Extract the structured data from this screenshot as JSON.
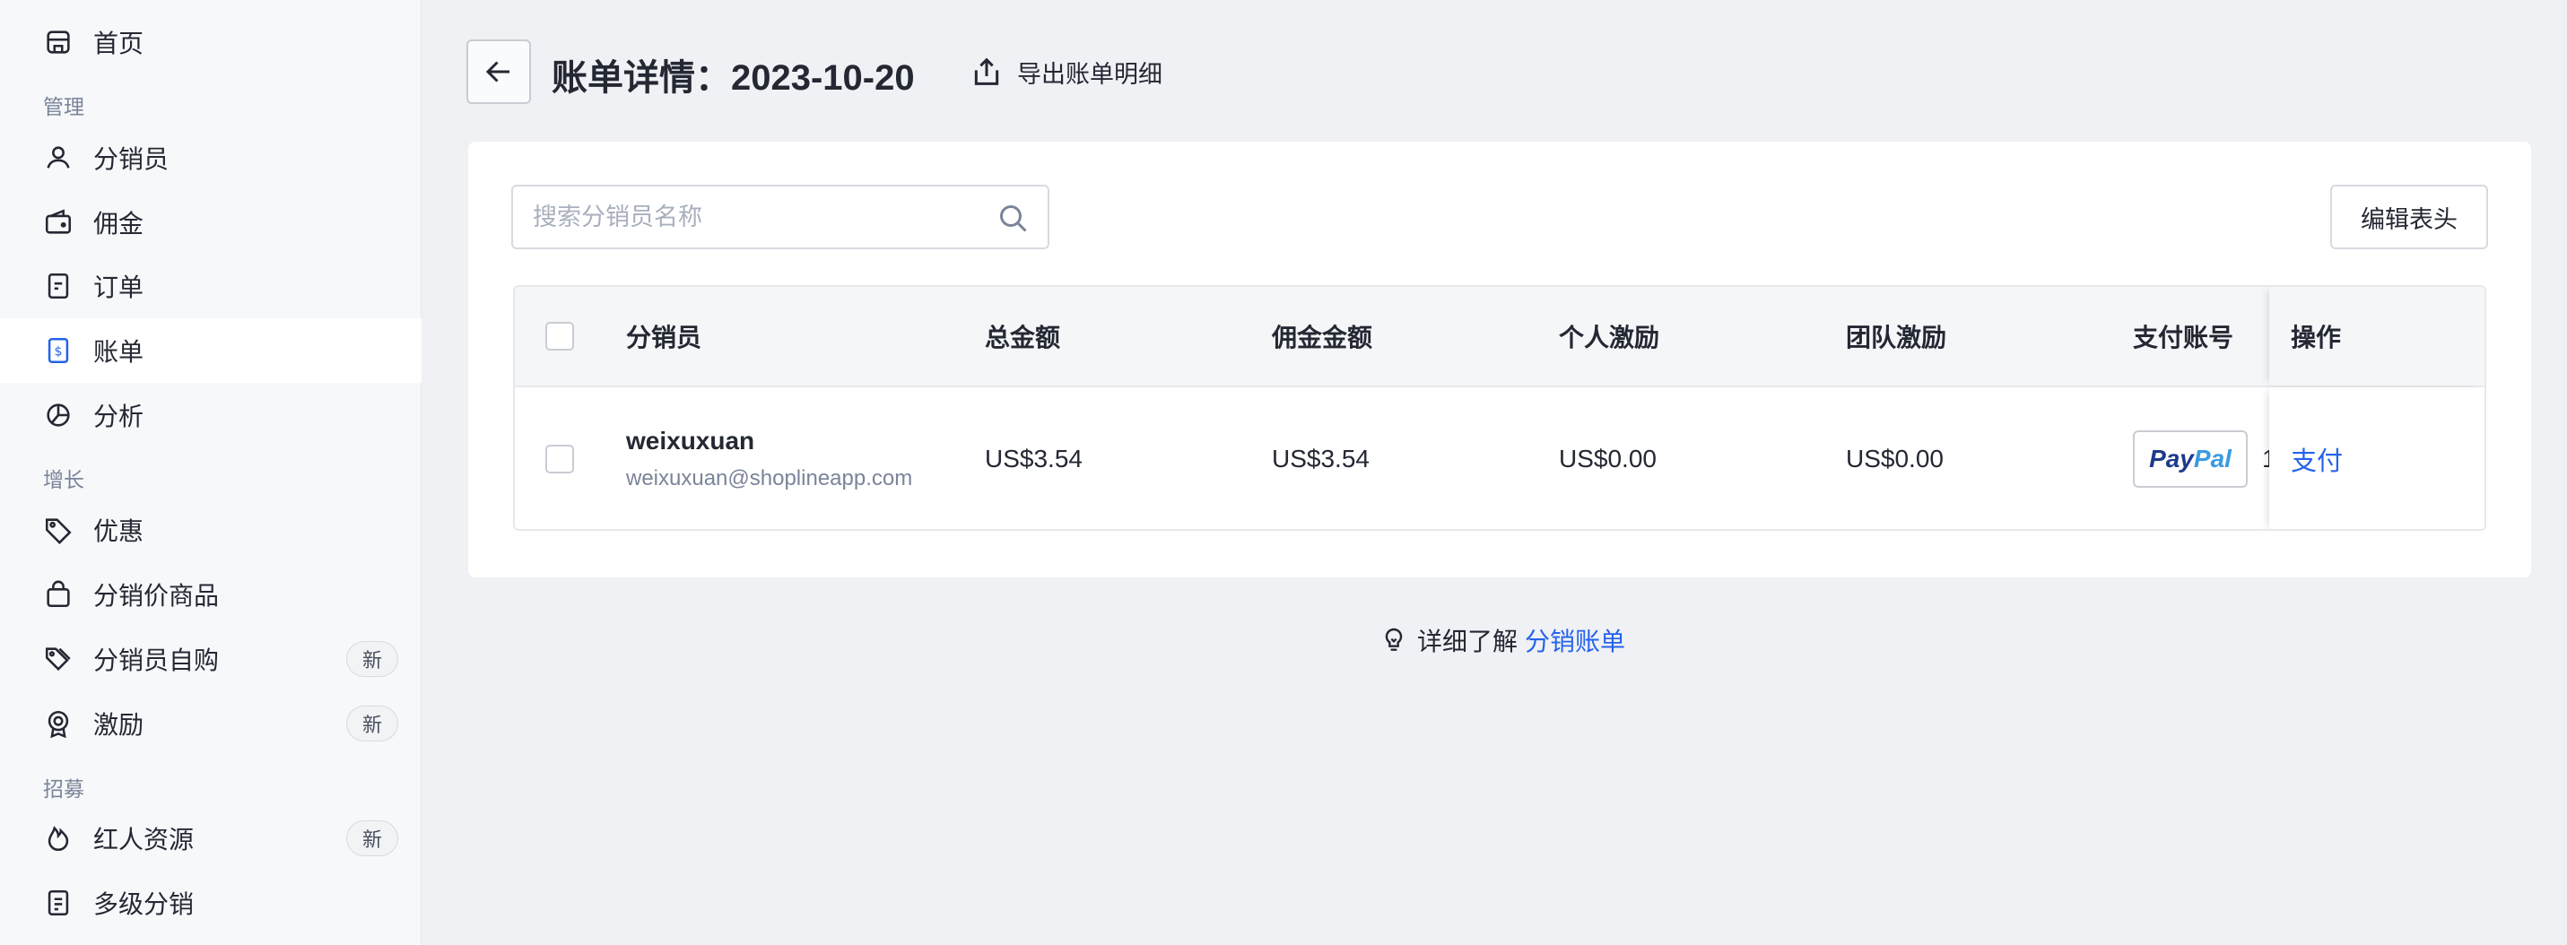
{
  "sidebar": {
    "items": [
      {
        "label": "首页",
        "icon": "store-icon"
      },
      {
        "label": "分销员",
        "icon": "user-icon"
      },
      {
        "label": "佣金",
        "icon": "wallet-icon"
      },
      {
        "label": "订单",
        "icon": "order-icon"
      },
      {
        "label": "账单",
        "icon": "bill-icon",
        "active": true
      },
      {
        "label": "分析",
        "icon": "pie-chart-icon"
      },
      {
        "label": "优惠",
        "icon": "tag-icon"
      },
      {
        "label": "分销价商品",
        "icon": "bag-icon"
      },
      {
        "label": "分销员自购",
        "icon": "tags-icon",
        "badge": "新"
      },
      {
        "label": "激励",
        "icon": "medal-icon",
        "badge": "新"
      },
      {
        "label": "红人资源",
        "icon": "flame-icon",
        "badge": "新"
      },
      {
        "label": "多级分销",
        "icon": "document-icon"
      }
    ],
    "sections": {
      "manage": "管理",
      "growth": "增长",
      "recruit": "招募"
    }
  },
  "header": {
    "title": "账单详情：2023-10-20",
    "export_label": "导出账单明细"
  },
  "search": {
    "placeholder": "搜索分销员名称"
  },
  "toolbar": {
    "edit_header_label": "编辑表头"
  },
  "table": {
    "columns": [
      "分销员",
      "总金额",
      "佣金金额",
      "个人激励",
      "团队激励",
      "支付账号",
      "操作"
    ],
    "rows": [
      {
        "name": "weixuxuan",
        "email": "weixuxuan@shoplineapp.com",
        "total": "US$3.54",
        "commission": "US$3.54",
        "personal_incentive": "US$0.00",
        "team_incentive": "US$0.00",
        "payment_account_brand": "PayPal",
        "payment_account_brand_part1": "Pay",
        "payment_account_brand_part2": "Pal",
        "payment_account_truncated": "1",
        "action": "支付"
      }
    ]
  },
  "footer": {
    "learn_more_prefix": "详细了解",
    "learn_more_link": "分销账单"
  },
  "colors": {
    "accent": "#2463eb",
    "text": "#242833",
    "muted": "#7a8499",
    "page_bg": "#f0f1f4"
  }
}
